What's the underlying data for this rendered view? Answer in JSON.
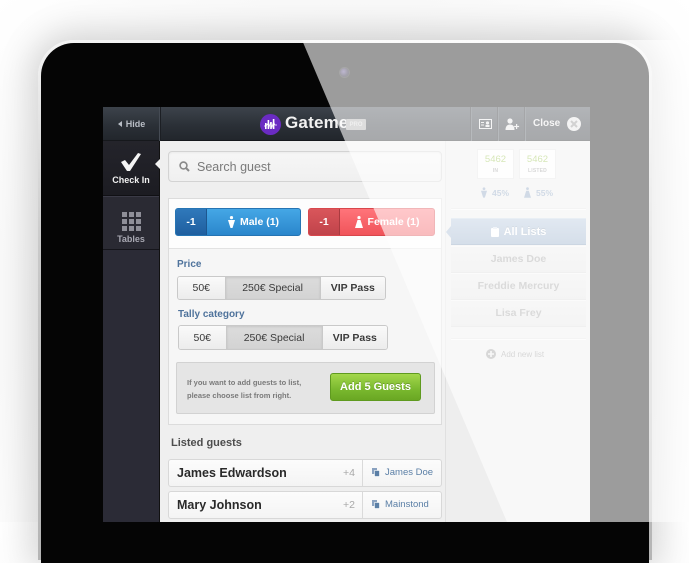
{
  "header": {
    "hide_label": "Hide",
    "brand": "Gateme",
    "badge": "PRO",
    "close_label": "Close",
    "icons": [
      "contact-card-icon",
      "add-user-icon",
      "close-icon"
    ]
  },
  "sidebar": {
    "items": [
      {
        "label": "Check In",
        "icon": "checkmark-icon",
        "active": true
      },
      {
        "label": "Tables",
        "icon": "grid-icon",
        "active": false
      }
    ]
  },
  "search": {
    "placeholder": "Search guest",
    "value": ""
  },
  "counters": {
    "male": {
      "decrement": "-1",
      "label": "Male (1)"
    },
    "female": {
      "decrement": "-1",
      "label": "Female (1)"
    }
  },
  "price": {
    "label": "Price",
    "options": [
      "50€",
      "250€ Special",
      "VIP Pass"
    ],
    "selected": "250€ Special"
  },
  "tally": {
    "label": "Tally category",
    "options": [
      "50€",
      "250€ Special",
      "VIP Pass"
    ],
    "selected": "250€ Special"
  },
  "add_box": {
    "hint_line1": "If you want to add guests to list,",
    "hint_line2": "please choose list from right.",
    "button": "Add 5 Guests"
  },
  "listed": {
    "title": "Listed guests",
    "rows": [
      {
        "name": "James Edwardson",
        "count": "+4",
        "list": "James Doe"
      },
      {
        "name": "Mary Johnson",
        "count": "+2",
        "list": "Mainstond"
      }
    ]
  },
  "stats": {
    "in": {
      "value": "5462",
      "label": "IN"
    },
    "listed": {
      "value": "5462",
      "label": "LISTED"
    },
    "male_pct": "45%",
    "female_pct": "55%"
  },
  "lists": {
    "all_label": "All Lists",
    "items": [
      "James Doe",
      "Freddie Mercury",
      "Lisa Frey"
    ],
    "add_label": "Add new list"
  },
  "colors": {
    "brand": "#6a2bc2",
    "male": "#2f8fd8",
    "female": "#f2585e",
    "green": "#79b82e",
    "stat-green": "#98c24b",
    "label-blue": "#4f739c",
    "pct": "#8aa2c0",
    "list-link": "#5b7fa6"
  }
}
